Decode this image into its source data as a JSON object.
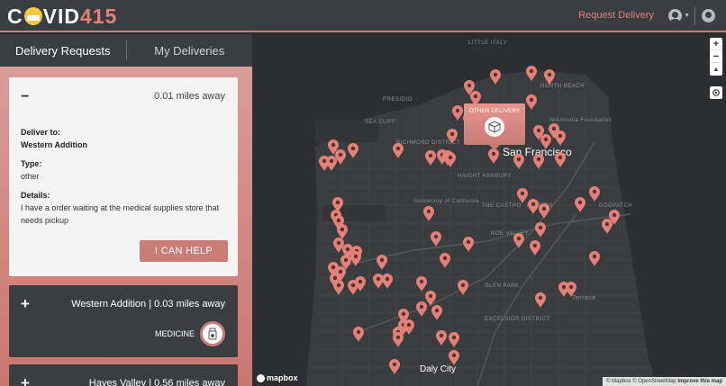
{
  "header": {
    "logo_c": "C",
    "logo_vid": "VID",
    "logo_num": "415",
    "request_link": "Request Delivery"
  },
  "sidebar": {
    "tabs": [
      {
        "label": "Delivery Requests",
        "active": true
      },
      {
        "label": "My Deliveries",
        "active": false
      }
    ],
    "open_card": {
      "toggle": "−",
      "distance": "0.01 miles away",
      "deliver_to_label": "Deliver to:",
      "deliver_to_value": "Western Addition",
      "type_label": "Type:",
      "type_value": "other",
      "details_label": "Details:",
      "details_value": "I have a order waiting at the medical supplies store that needs pickup",
      "help_button": "I CAN HELP"
    },
    "closed_cards": [
      {
        "toggle": "+",
        "title": "Western Addition | 0.03 miles away",
        "category": "MEDICINE",
        "category_icon": "medicine-icon"
      },
      {
        "toggle": "+",
        "title": "Hayes Valley | 0.56 miles away"
      }
    ]
  },
  "map": {
    "city_label": "San Francisco",
    "city_label_2": "Daly City",
    "labels": {
      "sea_cliff": "SEA CLIFF",
      "richmond": "RICHMOND DISTRICT",
      "haight": "HAIGHT ASHBURY",
      "ucsf": "University of California",
      "castro": "THE CASTRO",
      "mission": "MISSION",
      "noe": "NOE VALLEY",
      "glen_park": "GLEN PARK",
      "excelsior": "EXCELSIOR DISTRICT",
      "dogpatch": "DOGPATCH",
      "terrace": "Terrace",
      "little_italy": "LITTLE ITALY",
      "north_beach": "NORTH BEACH",
      "foundation": "Wikimedia Foundation",
      "presidio": "PRESIDIO"
    },
    "popup_title": "OTHER DELIVERY",
    "popup_icon": "package-icon",
    "zoom_in": "+",
    "zoom_out": "−",
    "compass": "▲",
    "locate_icon": "locate-icon",
    "mapbox_brand": "mapbox",
    "attribution_1": "© Mapbox © OpenStreetMap",
    "attribution_2": "Improve this map",
    "marker_color": "#e2807a"
  },
  "colors": {
    "accent": "#e2807a",
    "header_bg": "#3a3d41",
    "button": "#c97d77"
  }
}
